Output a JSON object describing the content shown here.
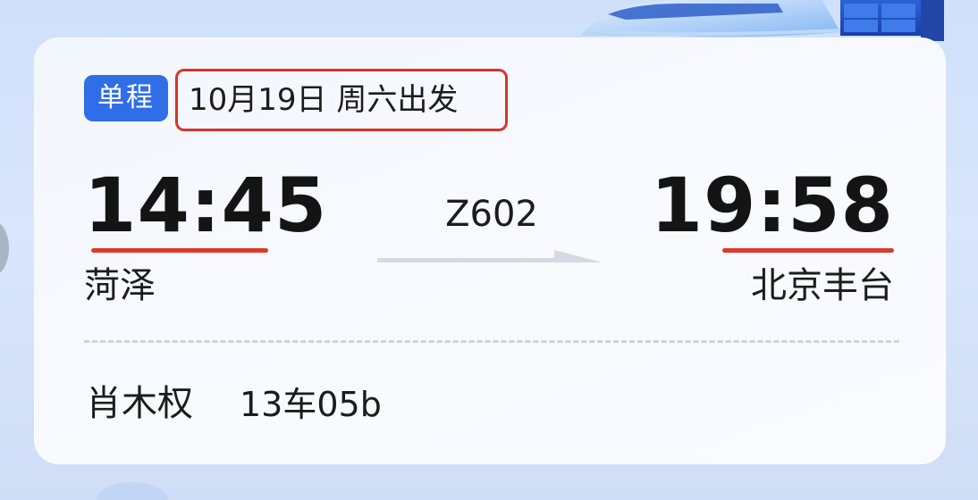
{
  "ticket": {
    "trip_type": "单程",
    "departure_date": "10月19日 周六出发",
    "departure": {
      "time": "14:45",
      "station": "菏泽"
    },
    "arrival": {
      "time": "19:58",
      "station": "北京丰台"
    },
    "train_number": "Z602",
    "passenger": {
      "name": "肖木权",
      "seat": "13车05b"
    }
  },
  "icons": {
    "train_illustration": "high-speed-train-illustration",
    "direction": "right-arrow-icon"
  },
  "colors": {
    "badge_bg": "#2f6ee6",
    "highlight_red": "#d9342b",
    "text_primary": "#141414",
    "background": "#d3e2fa",
    "card": "#f6f9fe"
  }
}
